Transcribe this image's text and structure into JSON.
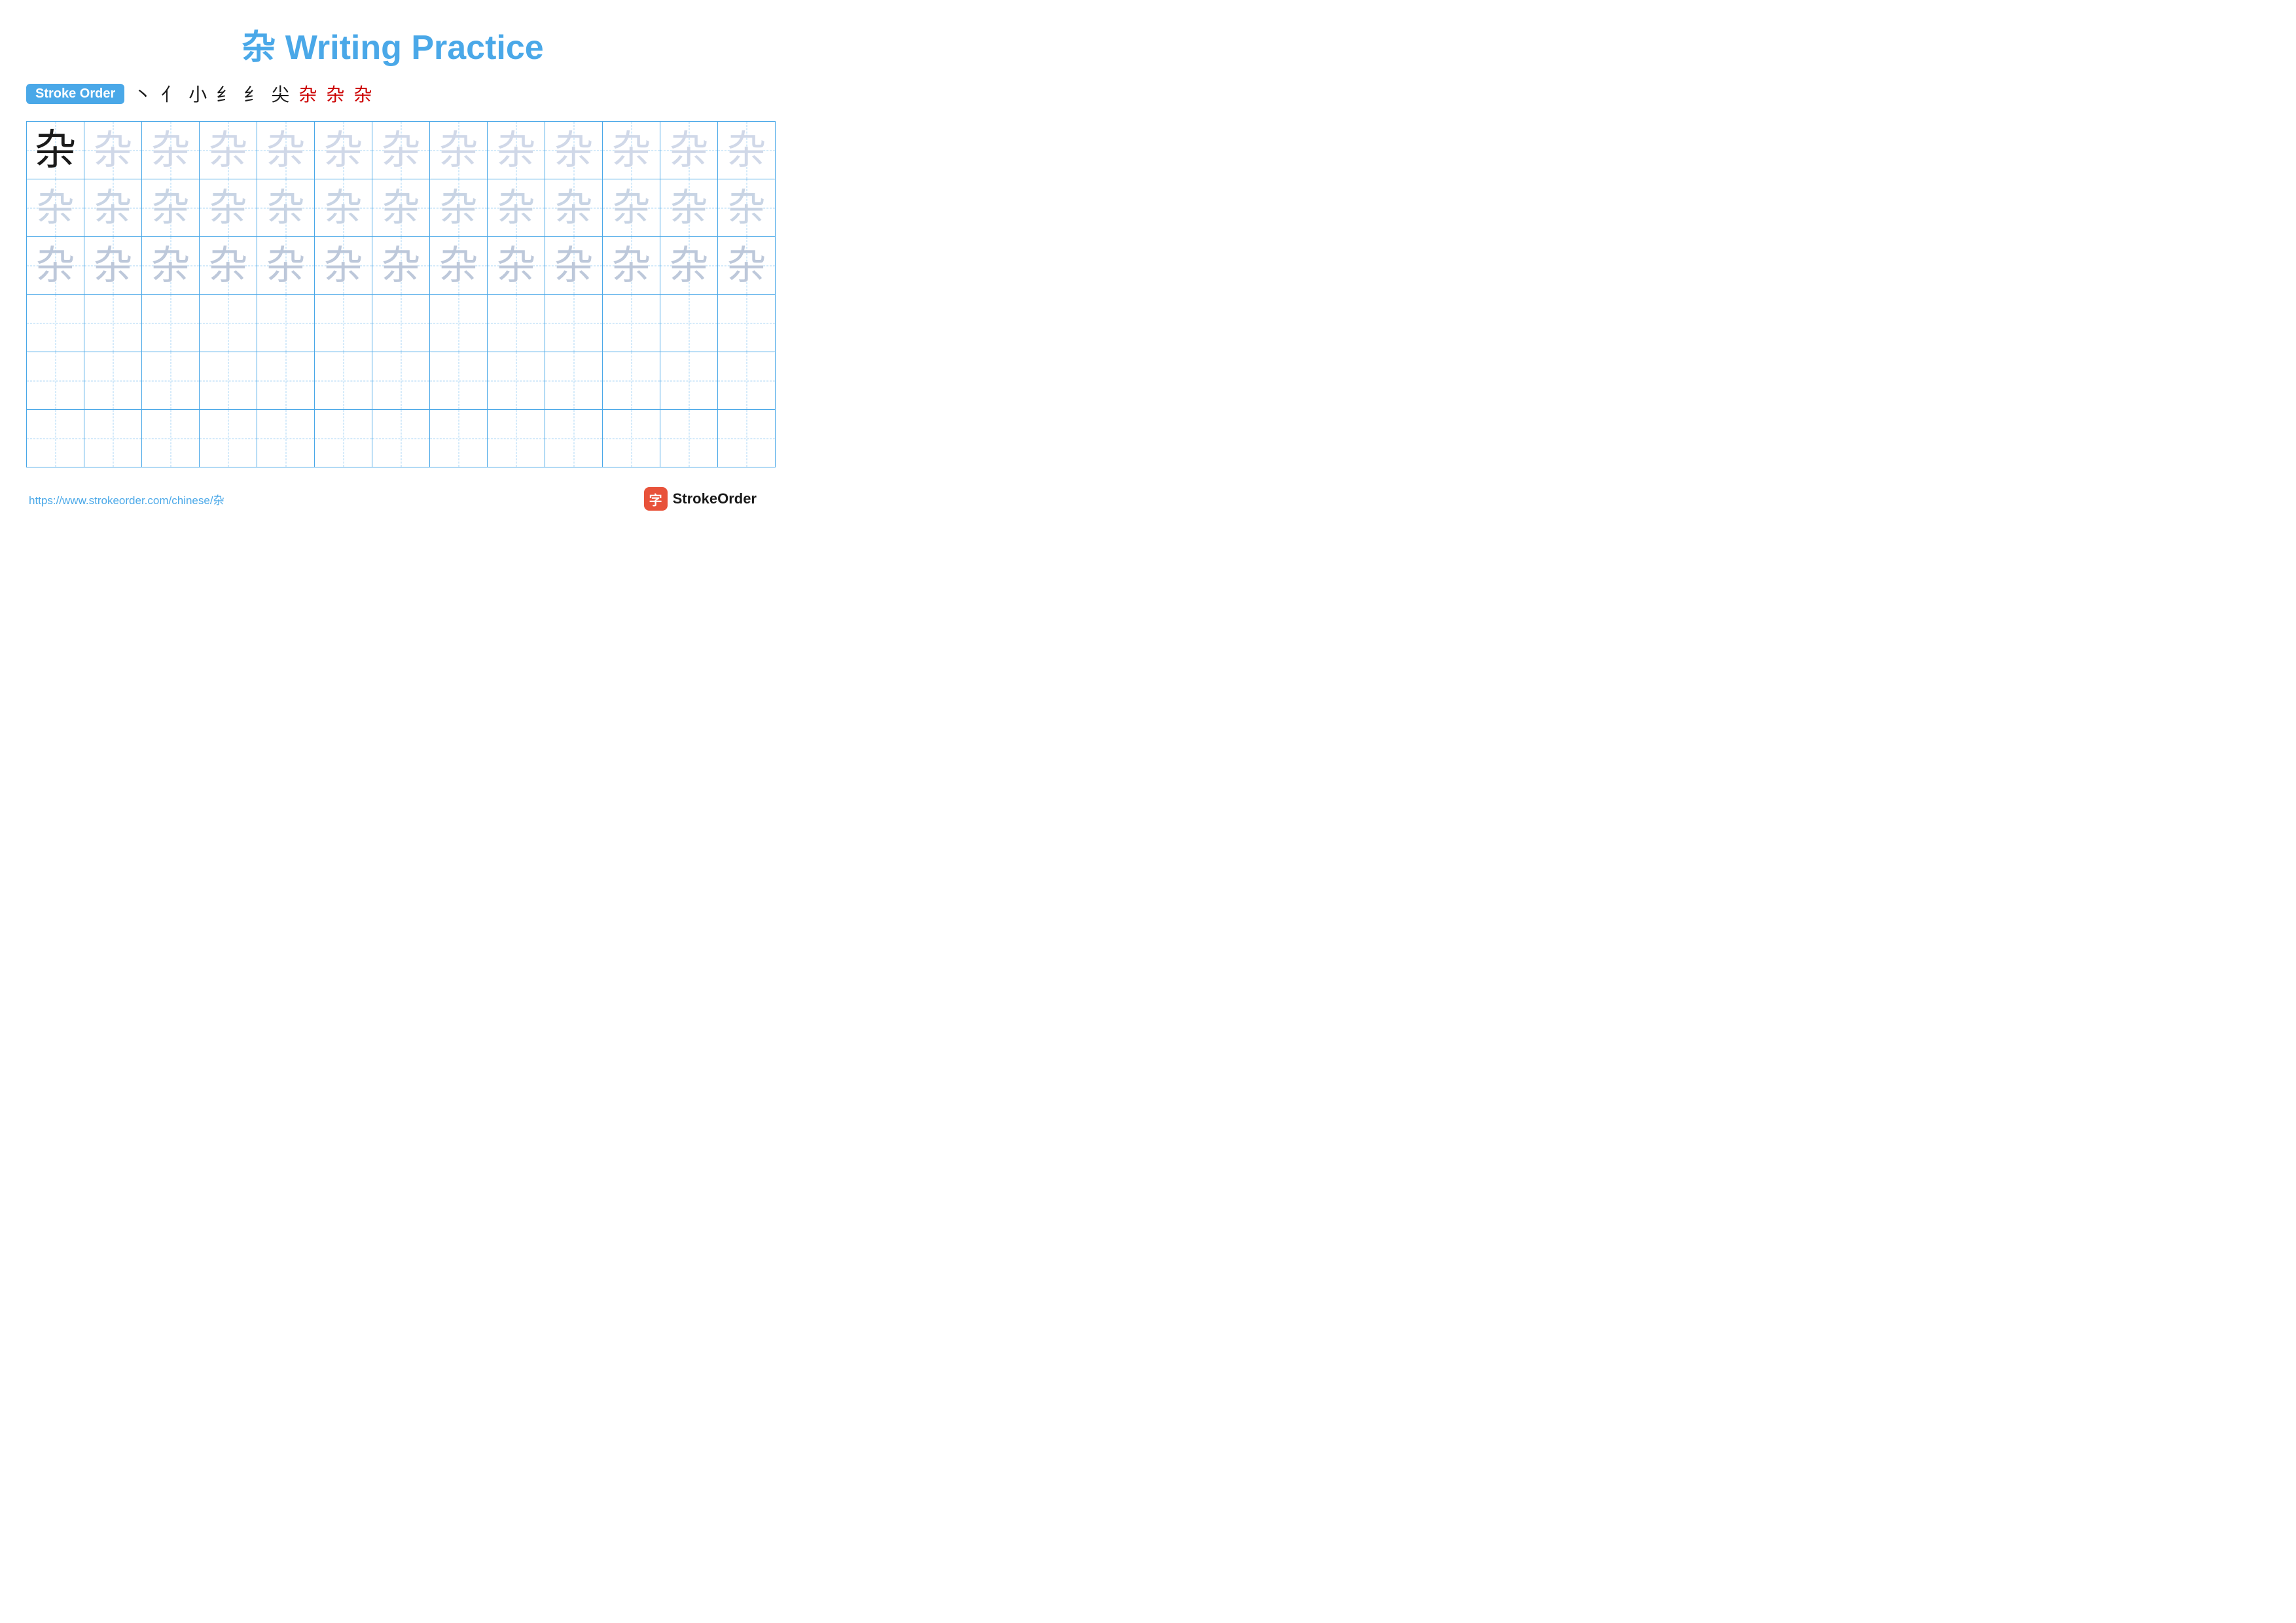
{
  "title": {
    "chinese_char": "杂",
    "english": "Writing Practice",
    "full": "杂 Writing Practice"
  },
  "stroke_order": {
    "badge_label": "Stroke Order",
    "steps": [
      "丶",
      "亻",
      "小",
      "纟",
      "纟",
      "尖",
      "杂",
      "杂",
      "杂"
    ]
  },
  "grid": {
    "rows": 6,
    "cols": 13,
    "char": "杂",
    "row1_solid_col": 0,
    "ghost_rows": [
      0,
      1,
      2
    ],
    "empty_rows": [
      3,
      4,
      5
    ]
  },
  "footer": {
    "link_text": "https://www.strokeorder.com/chinese/杂",
    "brand_name": "StrokeOrder",
    "brand_char": "字"
  }
}
